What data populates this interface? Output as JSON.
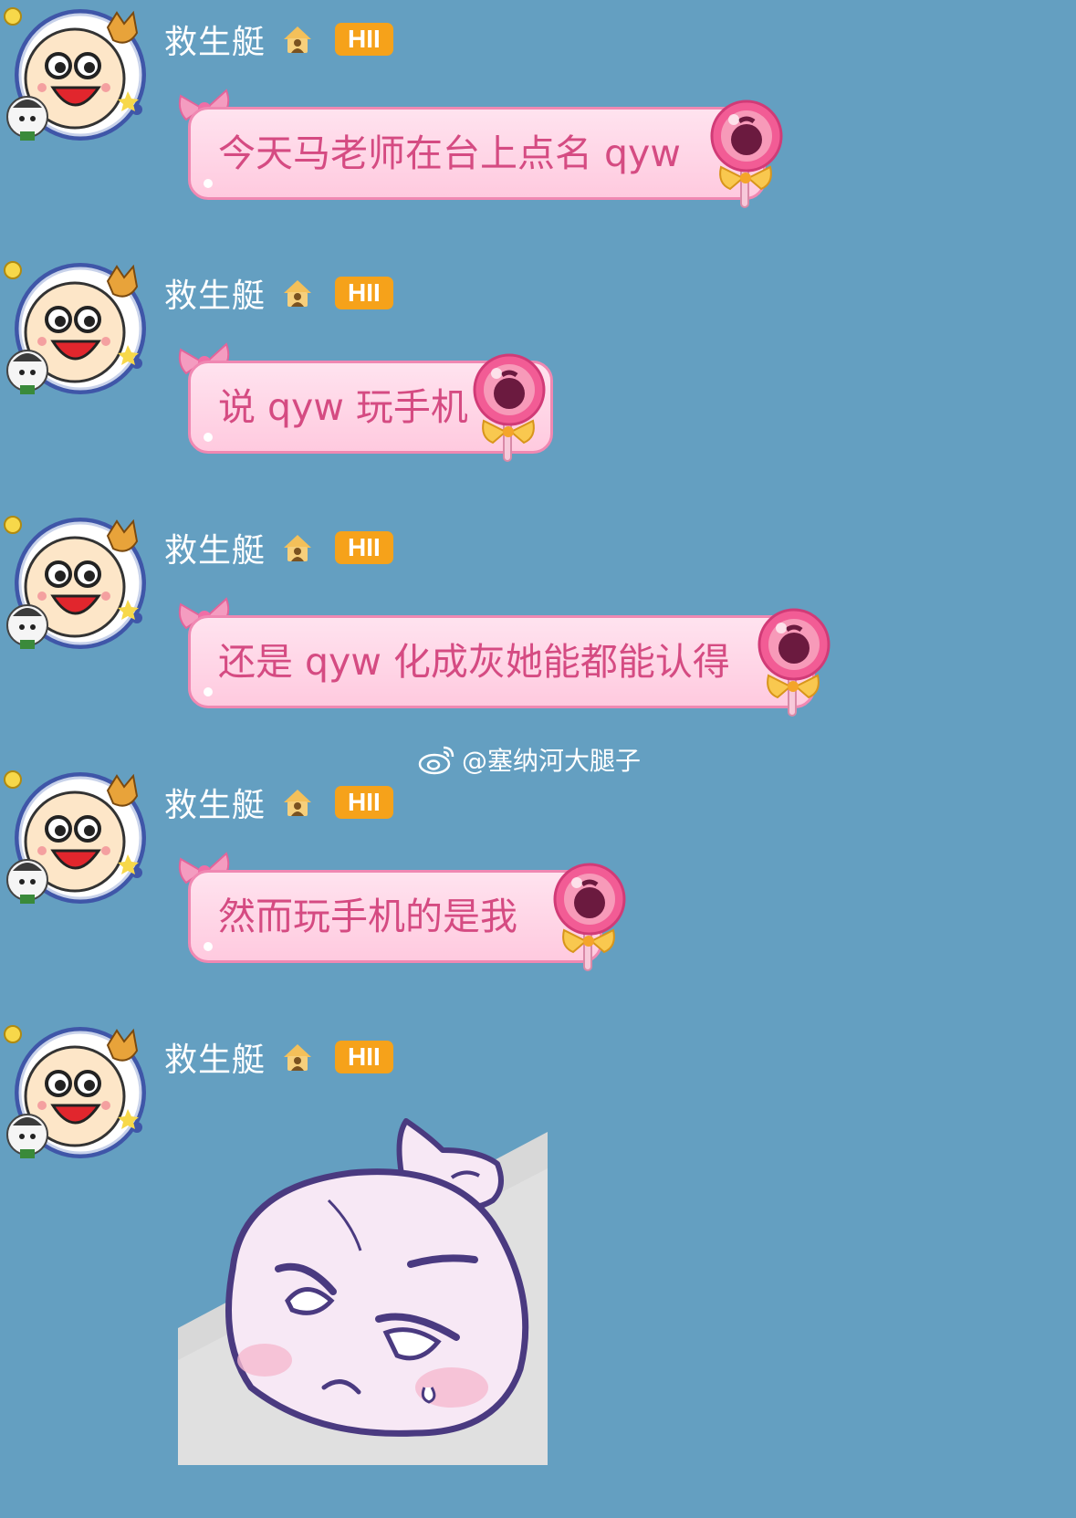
{
  "sender": {
    "name": "救生艇",
    "level_badge": "HII"
  },
  "messages": [
    {
      "text": "今天马老师在台上点名 qyw"
    },
    {
      "text": "说 qyw 玩手机"
    },
    {
      "text": "还是 qyw 化成灰她能都能认得"
    },
    {
      "text": "然而玩手机的是我"
    }
  ],
  "watermark": "@塞纳河大腿子",
  "colors": {
    "background": "#649fc1",
    "bubble_text": "#d54b82",
    "bubble_border": "#f088b2",
    "badge": "#f6a21a"
  }
}
